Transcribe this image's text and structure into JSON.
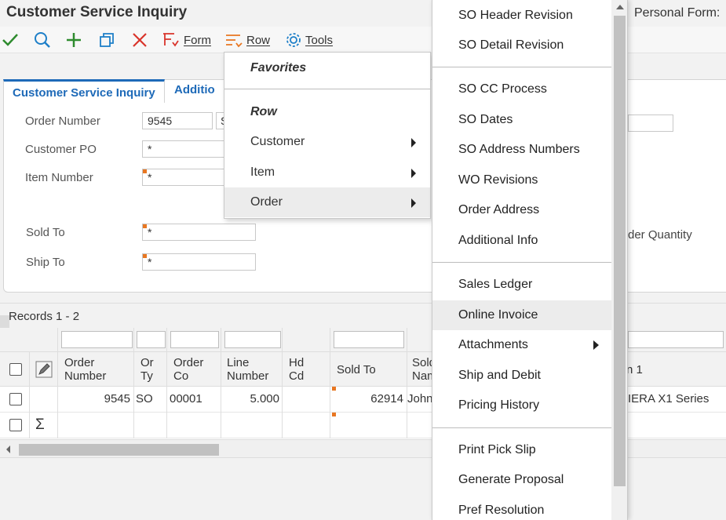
{
  "window": {
    "title": "Customer Service Inquiry",
    "personal_form_label": "Personal Form:"
  },
  "toolbar": {
    "form_label": "Form",
    "row_label": "Row",
    "tools_label": "Tools",
    "icons": [
      "check-icon",
      "search-icon",
      "add-icon",
      "copy-icon",
      "delete-icon",
      "form-menu-icon",
      "row-menu-icon",
      "tools-gear-icon"
    ],
    "colors": {
      "check": "#2e8b2e",
      "search": "#1e7fc8",
      "add": "#2e8b2e",
      "copy": "#1e7fc8",
      "delete": "#d9342b",
      "form": "#d9342b",
      "row": "#e87722",
      "tools": "#1e7fc8"
    }
  },
  "tabs": {
    "active": "Customer Service Inquiry",
    "second": "Additio"
  },
  "form": {
    "order_number": {
      "label": "Order Number",
      "value": "9545",
      "type_value": "S"
    },
    "customer_po": {
      "label": "Customer PO",
      "value": "*"
    },
    "item_number": {
      "label": "Item Number",
      "value": "*"
    },
    "sold_to": {
      "label": "Sold To",
      "value": "*"
    },
    "ship_to": {
      "label": "Ship To",
      "value": "*"
    },
    "partial_right_label": "der Quantity"
  },
  "grid": {
    "records": "Records 1 - 2",
    "collapse_glyph": "«",
    "columns": [
      {
        "line1": "Order",
        "line2": "Number"
      },
      {
        "line1": "Or",
        "line2": "Ty"
      },
      {
        "line1": "Order",
        "line2": "Co"
      },
      {
        "line1": "Line",
        "line2": "Number"
      },
      {
        "line1": "Hd",
        "line2": "Cd"
      },
      {
        "line1": "Sold To",
        "line2": ""
      },
      {
        "line1": "Sold",
        "line2": "Nam"
      },
      {
        "line1": "n 1",
        "line2": ""
      }
    ],
    "rows": [
      {
        "order_number": "9545",
        "or_ty": "SO",
        "order_co": "00001",
        "line_number": "5.000",
        "hd_cd": "",
        "sold_to": "62914",
        "sold_name": "John",
        "description": "IERA X1 Series"
      }
    ],
    "total_row_symbol": "Σ"
  },
  "row_menu": {
    "favorites": "Favorites",
    "row_section": "Row",
    "items": [
      {
        "label": "Customer",
        "submenu": true
      },
      {
        "label": "Item",
        "submenu": true
      },
      {
        "label": "Order",
        "submenu": true,
        "highlighted": true
      }
    ]
  },
  "order_submenu": {
    "group1": [
      "SO Header Revision",
      "SO Detail Revision"
    ],
    "group2": [
      "SO CC Process",
      "SO Dates",
      "SO Address Numbers",
      "WO Revisions",
      "Order Address",
      "Additional Info"
    ],
    "group3": [
      "Sales Ledger",
      "Online Invoice",
      "Attachments",
      "Ship and Debit",
      "Pricing History"
    ],
    "group4": [
      "Print Pick Slip",
      "Generate Proposal",
      "Pref Resolution"
    ],
    "highlighted": "Online Invoice"
  },
  "colors": {
    "tab_blue": "#1e6ab8",
    "required_marker": "#e87722",
    "menu_hover": "#ececec"
  }
}
